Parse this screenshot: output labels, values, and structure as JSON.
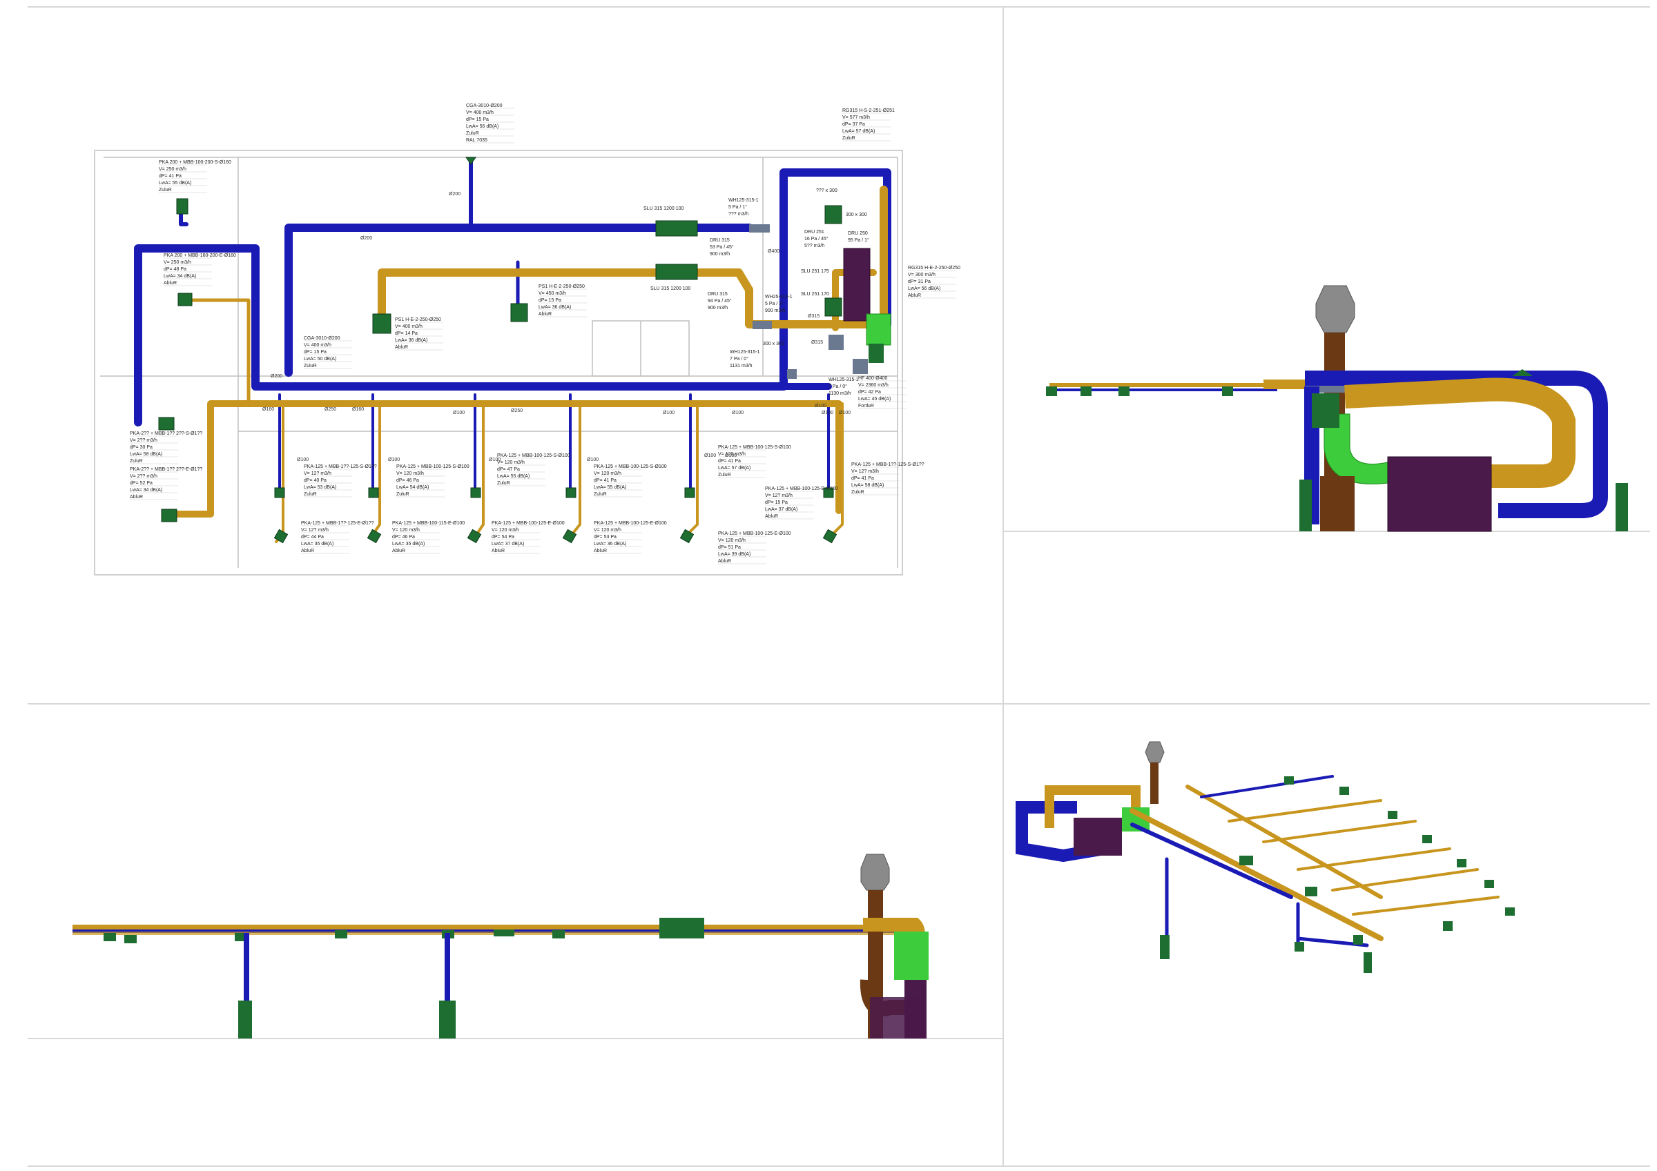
{
  "colors": {
    "supply_duct": "#1a1ab4",
    "exhaust_duct": "#c8961e",
    "terminal": "#1e6e32",
    "damper": "#3ccc3c",
    "unit": "#4a1a4a",
    "riser": "#6b3a14",
    "hood": "#888888",
    "fitting": "#6a7890"
  },
  "plan_labels": [
    {
      "id": "cga-top",
      "lines": [
        "CGA-3010-Ø200",
        "V= 400 m3/h",
        "dP= 15 Pa",
        "LwA= 56 dB(A)",
        "ZuluR",
        "RAL 7035"
      ]
    },
    {
      "id": "rg-top",
      "lines": [
        "RG315 H-S-2-251-Ø251",
        "V= 577 m3/h",
        "dP= 37 Pa",
        "LwA= 57 dB(A)",
        "ZuluR"
      ]
    },
    {
      "id": "pka-1",
      "lines": [
        "PKA 200 + MBB-100-200-S-Ø160",
        "V= 250 m3/h",
        "dP= 41 Pa",
        "LwA= 55 dB(A)",
        "ZuluR"
      ]
    },
    {
      "id": "pka-2",
      "lines": [
        "PKA 200 + MBB-160-200-E-Ø160",
        "V= 250 m3/h",
        "dP= 48 Pa",
        "LwA= 34 dB(A)",
        "AbluR"
      ]
    },
    {
      "id": "psi-1",
      "lines": [
        "PS1 H-E-2-250-Ø250",
        "V= 450 m3/h",
        "dP= 15 Pa",
        "LwA= 36 dB(A)",
        "AbluR"
      ]
    },
    {
      "id": "psi-2",
      "lines": [
        "PS1 H-E-2-250-Ø250",
        "V= 400 m3/h",
        "dP= 14 Pa",
        "LwA= 36 dB(A)",
        "AbluR"
      ]
    },
    {
      "id": "cga-mid",
      "lines": [
        "CGA-3010-Ø200",
        "V= 400 m3/h",
        "dP= 15 Pa",
        "LwA= 50 dB(A)",
        "ZuluR"
      ]
    },
    {
      "id": "rg-right",
      "lines": [
        "RG315 H-E-2-250-Ø250",
        "V= 300 m3/h",
        "dP= 31 Pa",
        "LwA= 56 dB(A)",
        "AbluR"
      ]
    },
    {
      "id": "pka-3",
      "lines": [
        "PKA-2?? + MBB-1?? 2??-S-Ø1??",
        "V= 2?? m3/h",
        "dP= 30 Pa",
        "LwA= 58 dB(A)",
        "ZuluR"
      ]
    },
    {
      "id": "pka-4",
      "lines": [
        "PKA-2?? + MBB-1?? 2??-E-Ø1??",
        "V= 2?? m3/h",
        "dP= 52 Pa",
        "LwA= 34 dB(A)",
        "AbluR"
      ]
    },
    {
      "id": "pka-5",
      "lines": [
        "PKA-125 + MBB-1??-125-S-Ø1??",
        "V= 12? m3/h",
        "dP= 40 Pa",
        "LwA= 53 dB(A)",
        "ZuluR"
      ]
    },
    {
      "id": "pka-6",
      "lines": [
        "PKA-125 + MBB-100-125-S-Ø100",
        "V= 120 m3/h",
        "dP= 46 Pa",
        "LwA= 54 dB(A)",
        "ZuluR"
      ]
    },
    {
      "id": "pka-7",
      "lines": [
        "PKA-125 + MBB-100-125-S-Ø100",
        "V= 120 m3/h",
        "dP= 47 Pa",
        "LwA= 55 dB(A)",
        "ZuluR"
      ]
    },
    {
      "id": "pka-8",
      "lines": [
        "PKA-125 + MBB-100-125-S-Ø100",
        "V= 120 m3/h",
        "dP= 41 Pa",
        "LwA= 55 dB(A)",
        "ZuluR"
      ]
    },
    {
      "id": "pka-9",
      "lines": [
        "PKA-125 + MBB-100-125-S-Ø100",
        "V= 120 m3/h",
        "dP= 41 Pa",
        "LwA= 57 dB(A)",
        "ZuluR"
      ]
    },
    {
      "id": "pka-10",
      "lines": [
        "PKA-125 + MBB-1??-125-S-Ø1??",
        "V= 12? m3/h",
        "dP= 41 Pa",
        "LwA= 58 dB(A)",
        "ZuluR"
      ]
    },
    {
      "id": "pka-11",
      "lines": [
        "PKA-125 + MBB-100-125-E-Ø100",
        "V= 12? m3/h",
        "dP= 15 Pa",
        "LwA= 37 dB(A)",
        "AbluR"
      ]
    },
    {
      "id": "pka-12",
      "lines": [
        "PKA-125 + MBB-1??-125-E-Ø1??",
        "V= 12? m3/h",
        "dP= 44 Pa",
        "LwA= 35 dB(A)",
        "AbluR"
      ]
    },
    {
      "id": "pka-13",
      "lines": [
        "PKA-125 + MBB-100-115-E-Ø100",
        "V= 120 m3/h",
        "dP= 46 Pa",
        "LwA= 35 dB(A)",
        "AbluR"
      ]
    },
    {
      "id": "pka-14",
      "lines": [
        "PKA-125 + MBB-100-125-E-Ø100",
        "V= 120 m3/h",
        "dP= 54 Pa",
        "LwA= 37 dB(A)",
        "AbluR"
      ]
    },
    {
      "id": "pka-15",
      "lines": [
        "PKA-125 + MBB-100-125-E-Ø100",
        "V= 120 m3/h",
        "dP= 53 Pa",
        "LwA= 36 dB(A)",
        "AbluR"
      ]
    },
    {
      "id": "pka-16",
      "lines": [
        "PKA-125 + MBB-100-125-E-Ø100",
        "V= 120 m3/h",
        "dP= 51 Pa",
        "LwA= 39 dB(A)",
        "AbluR"
      ]
    },
    {
      "id": "hf-400",
      "lines": [
        "HF 400-Ø400",
        "V= 2360 m3/h",
        "dP= 42 Pa",
        "LwA= 45 dB(A)",
        "FortluR"
      ]
    }
  ],
  "component_labels": [
    {
      "id": "slu-315-a",
      "text": "SLU 315 1200 100"
    },
    {
      "id": "slu-315-b",
      "text": "SLU 315 1200 100"
    },
    {
      "id": "slu-251",
      "text": "SLU 251 175"
    },
    {
      "id": "slu-251-b",
      "text": "SLU 251 170"
    },
    {
      "id": "wh-1",
      "lines": [
        "WH125-315-1",
        "5 Pa / 1°",
        "??? m3/h"
      ]
    },
    {
      "id": "dru-315-a",
      "lines": [
        "DRU 315",
        "53 Pa / 45°",
        "900 m3/h"
      ]
    },
    {
      "id": "dru-315-b",
      "lines": [
        "DRU 315",
        "94 Pa / 45°",
        "900 m3/h"
      ]
    },
    {
      "id": "dru-251",
      "lines": [
        "DRU 251",
        "16 Pa / 45°",
        "5?? m3/h"
      ]
    },
    {
      "id": "dru-250",
      "lines": [
        "DRU 250",
        "95 Pa / 1°"
      ]
    },
    {
      "id": "wh-2",
      "lines": [
        "WH25-315-1",
        "5 Pa / 3°",
        "900 m3/h"
      ]
    },
    {
      "id": "wh-3",
      "lines": [
        "WH125-315-1",
        "7 Pa / 0°",
        "1131 m3/h"
      ]
    },
    {
      "id": "wh-4",
      "lines": [
        "WH125-315-1",
        "7 Pa / 0°",
        "1130 m3/h"
      ]
    },
    {
      "id": "size-1",
      "text": "??? x 300"
    },
    {
      "id": "size-2",
      "text": "300 x 300"
    },
    {
      "id": "size-3",
      "text": "300 x 300"
    }
  ],
  "diameter_labels": [
    "Ø200",
    "Ø200",
    "Ø400",
    "Ø315",
    "Ø315",
    "Ø200",
    "Ø250",
    "Ø250",
    "Ø160",
    "Ø160",
    "Ø100",
    "Ø100",
    "Ø100",
    "Ø100",
    "Ø100",
    "Ø100",
    "Ø100",
    "Ø100",
    "Ø100",
    "Ø100",
    "Ø100",
    "Ø100"
  ]
}
